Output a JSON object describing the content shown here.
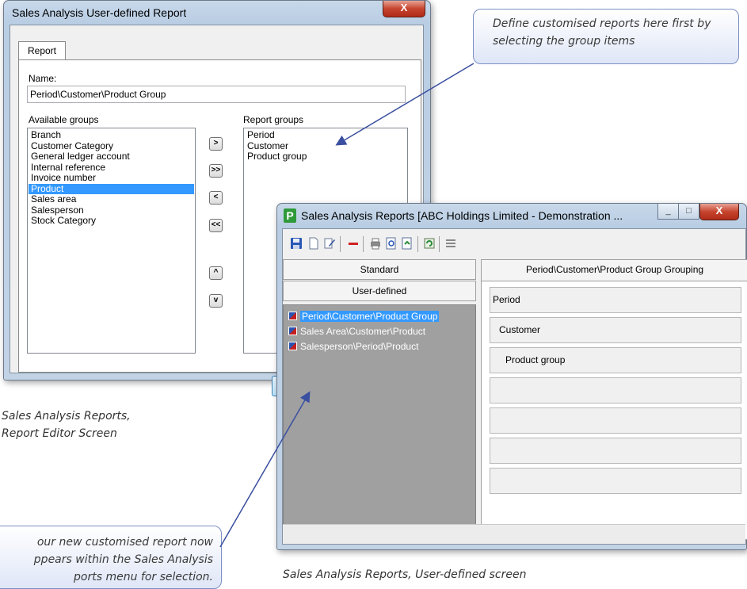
{
  "editor_window": {
    "title": "Sales Analysis User-defined Report",
    "close_glyph": "X",
    "tab_label": "Report",
    "name_label": "Name:",
    "name_value": "Period\\Customer\\Product Group",
    "available_label": "Available groups",
    "report_groups_label": "Report groups",
    "available_groups": [
      "Branch",
      "Customer Category",
      "General ledger account",
      "Internal reference",
      "Invoice number",
      "Product",
      "Sales area",
      "Salesperson",
      "Stock Category"
    ],
    "selected_available": "Product",
    "report_groups": [
      "Period",
      "Customer",
      "Product group"
    ],
    "buttons": {
      "add": ">",
      "add_all": ">>",
      "remove": "<",
      "remove_all": "<<",
      "move_up": "^",
      "move_down": "v"
    }
  },
  "reports_window": {
    "title": "Sales Analysis Reports [ABC Holdings Limited - Demonstration ...",
    "app_icon_letter": "P",
    "sys_buttons": {
      "minimize": "_",
      "maximize": "□",
      "close": "X"
    },
    "toolbar_icons": [
      "save-icon",
      "new-icon",
      "edit-icon",
      "delete-icon",
      "print-icon",
      "preview-icon",
      "export-icon",
      "refresh-icon",
      "columns-icon"
    ],
    "standard_header": "Standard",
    "userdefined_header": "User-defined",
    "reports": [
      "Period\\Customer\\Product Group",
      "Sales Area\\Customer\\Product",
      "Salesperson\\Period\\Product"
    ],
    "selected_report": "Period\\Customer\\Product Group",
    "grouping_header": "Period\\Customer\\Product Group Grouping",
    "grouping_slots": [
      "Period",
      "Customer",
      "Product group",
      "",
      "",
      "",
      ""
    ]
  },
  "callouts": {
    "top": "Define customised reports here first by selecting the group items",
    "bottom_lines": [
      "our new customised report now",
      "ppears within the Sales Analysis",
      "ports menu for selection."
    ]
  },
  "captions": {
    "editor_lines": [
      "Sales Analysis Reports,",
      "Report Editor Screen"
    ],
    "reports": "Sales Analysis Reports, User-defined screen"
  }
}
